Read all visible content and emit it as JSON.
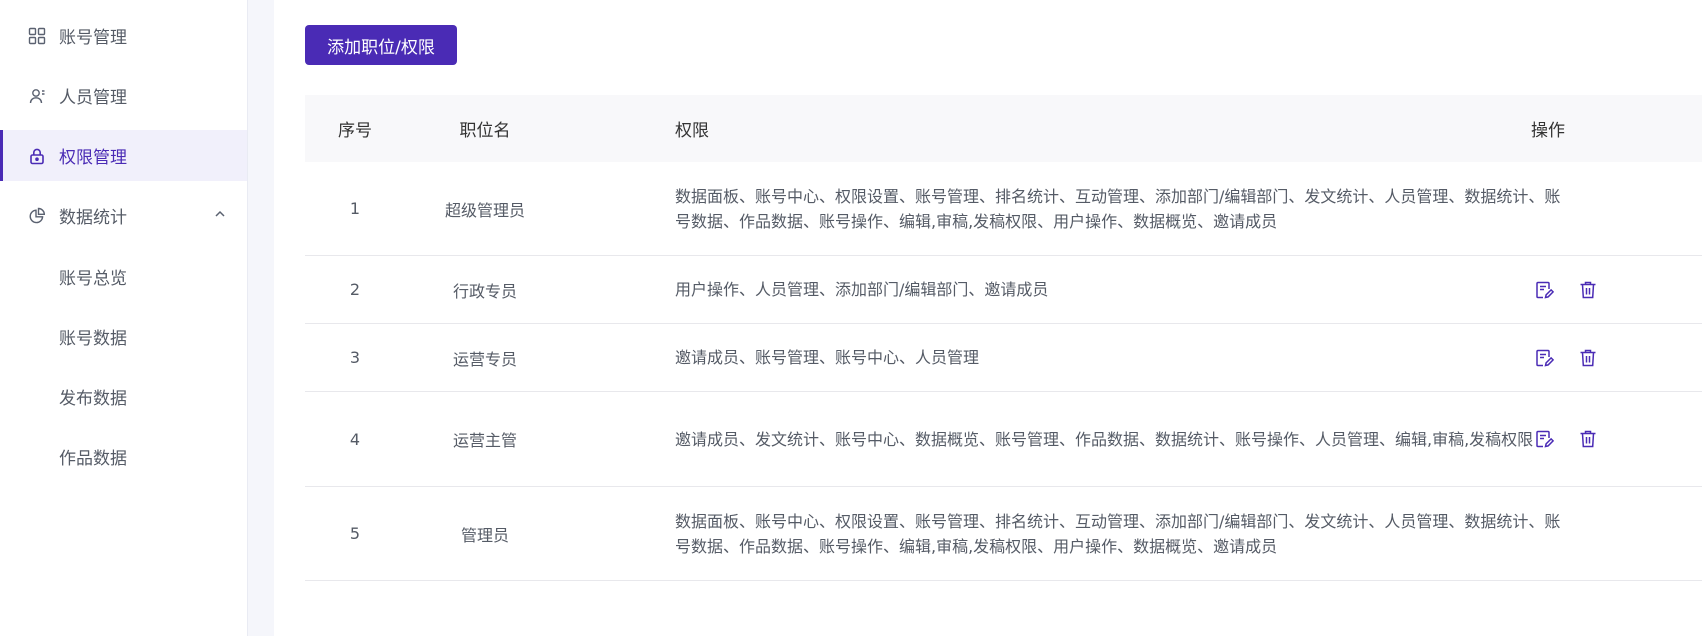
{
  "sidebar": {
    "items": [
      {
        "label": "账号管理",
        "icon": "grid-icon"
      },
      {
        "label": "人员管理",
        "icon": "user-icon"
      },
      {
        "label": "权限管理",
        "icon": "lock-icon",
        "active": true
      },
      {
        "label": "数据统计",
        "icon": "pie-chart-icon",
        "expanded": true
      }
    ],
    "subitems": [
      {
        "label": "账号总览"
      },
      {
        "label": "账号数据"
      },
      {
        "label": "发布数据"
      },
      {
        "label": "作品数据"
      }
    ]
  },
  "toolbar": {
    "add_label": "添加职位/权限"
  },
  "table": {
    "headers": {
      "index": "序号",
      "name": "职位名",
      "permissions": "权限",
      "actions": "操作"
    },
    "rows": [
      {
        "index": "1",
        "name": "超级管理员",
        "permissions": "数据面板、账号中心、权限设置、账号管理、排名统计、互动管理、添加部门/编辑部门、发文统计、人员管理、数据统计、账号数据、作品数据、账号操作、编辑,审稿,发稿权限、用户操作、数据概览、邀请成员",
        "has_actions": false
      },
      {
        "index": "2",
        "name": "行政专员",
        "permissions": "用户操作、人员管理、添加部门/编辑部门、邀请成员",
        "has_actions": true
      },
      {
        "index": "3",
        "name": "运营专员",
        "permissions": "邀请成员、账号管理、账号中心、人员管理",
        "has_actions": true
      },
      {
        "index": "4",
        "name": "运营主管",
        "permissions": "邀请成员、发文统计、账号中心、数据概览、账号管理、作品数据、数据统计、账号操作、人员管理、编辑,审稿,发稿权限",
        "has_actions": true
      },
      {
        "index": "5",
        "name": "管理员",
        "permissions": "数据面板、账号中心、权限设置、账号管理、排名统计、互动管理、添加部门/编辑部门、发文统计、人员管理、数据统计、账号数据、作品数据、账号操作、编辑,审稿,发稿权限、用户操作、数据概览、邀请成员",
        "has_actions": false
      }
    ]
  },
  "colors": {
    "accent": "#4a2bb5",
    "text": "#555b66",
    "header_bg": "#f8f8fa"
  }
}
